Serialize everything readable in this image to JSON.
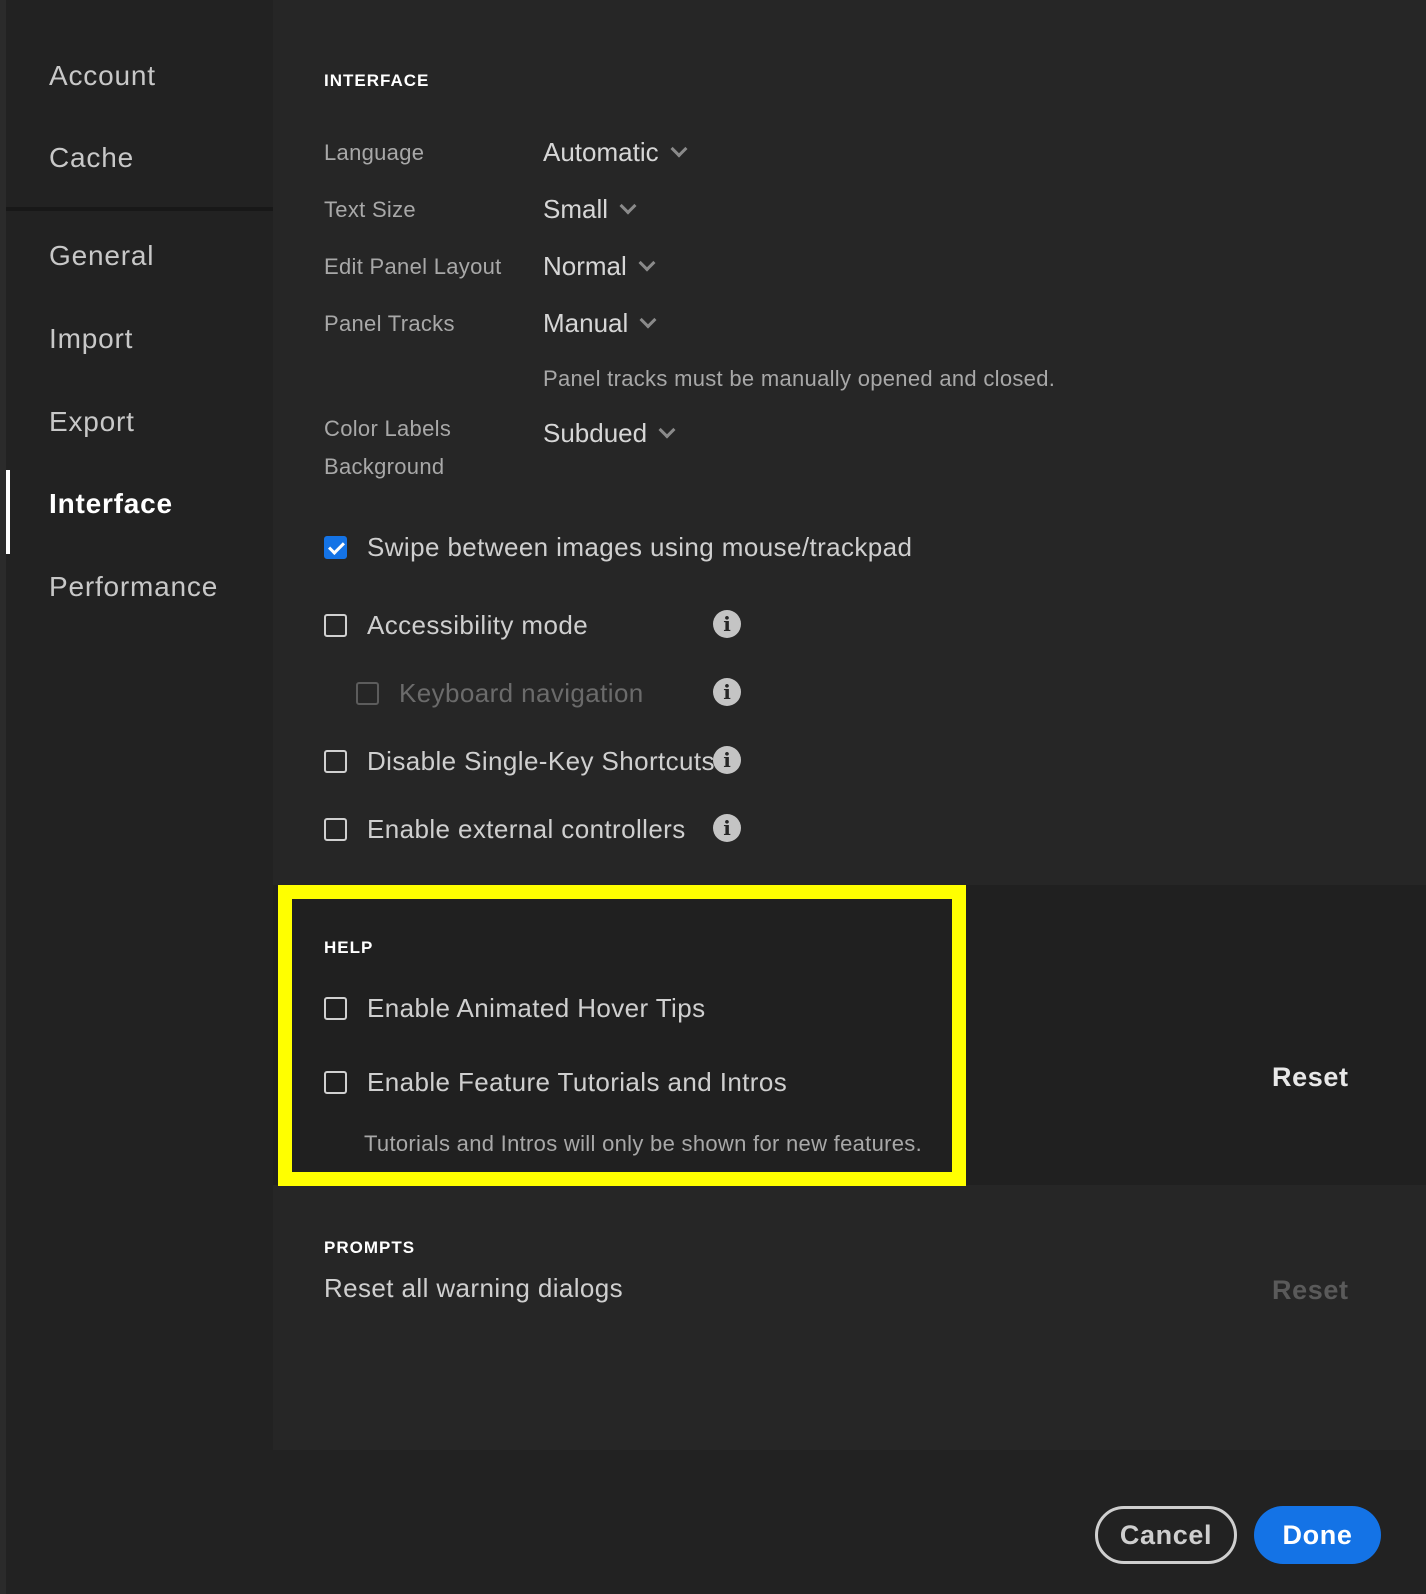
{
  "sidebar": {
    "items": [
      {
        "label": "Account"
      },
      {
        "label": "Cache"
      },
      {
        "label": "General"
      },
      {
        "label": "Import"
      },
      {
        "label": "Export"
      },
      {
        "label": "Interface"
      },
      {
        "label": "Performance"
      }
    ],
    "active": "Interface"
  },
  "interface": {
    "title": "INTERFACE",
    "language": {
      "label": "Language",
      "value": "Automatic"
    },
    "text_size": {
      "label": "Text Size",
      "value": "Small"
    },
    "edit_panel_layout": {
      "label": "Edit Panel Layout",
      "value": "Normal"
    },
    "panel_tracks": {
      "label": "Panel Tracks",
      "value": "Manual",
      "hint": "Panel tracks must be manually opened and closed."
    },
    "color_labels": {
      "label_line1": "Color Labels",
      "label_line2": "Background",
      "value": "Subdued"
    },
    "swipe": {
      "label": "Swipe between images using mouse/trackpad",
      "checked": true
    },
    "accessibility": {
      "label": "Accessibility mode",
      "checked": false
    },
    "keyboard_nav": {
      "label": "Keyboard navigation",
      "checked": false,
      "disabled": true
    },
    "single_key": {
      "label": "Disable Single-Key Shortcuts",
      "checked": false
    },
    "controllers": {
      "label": "Enable external controllers",
      "checked": false
    },
    "info_glyph": "i"
  },
  "help": {
    "title": "HELP",
    "hover_tips": {
      "label": "Enable Animated Hover Tips",
      "checked": false
    },
    "tutorials": {
      "label": "Enable Feature Tutorials and Intros",
      "checked": false
    },
    "hint": "Tutorials and Intros will only be shown for new features.",
    "reset_label": "Reset"
  },
  "prompts": {
    "title": "PROMPTS",
    "label": "Reset all warning dialogs",
    "reset_label": "Reset"
  },
  "footer": {
    "cancel_label": "Cancel",
    "done_label": "Done"
  },
  "colors": {
    "accent": "#1473e6",
    "highlight": "#ffff00"
  }
}
